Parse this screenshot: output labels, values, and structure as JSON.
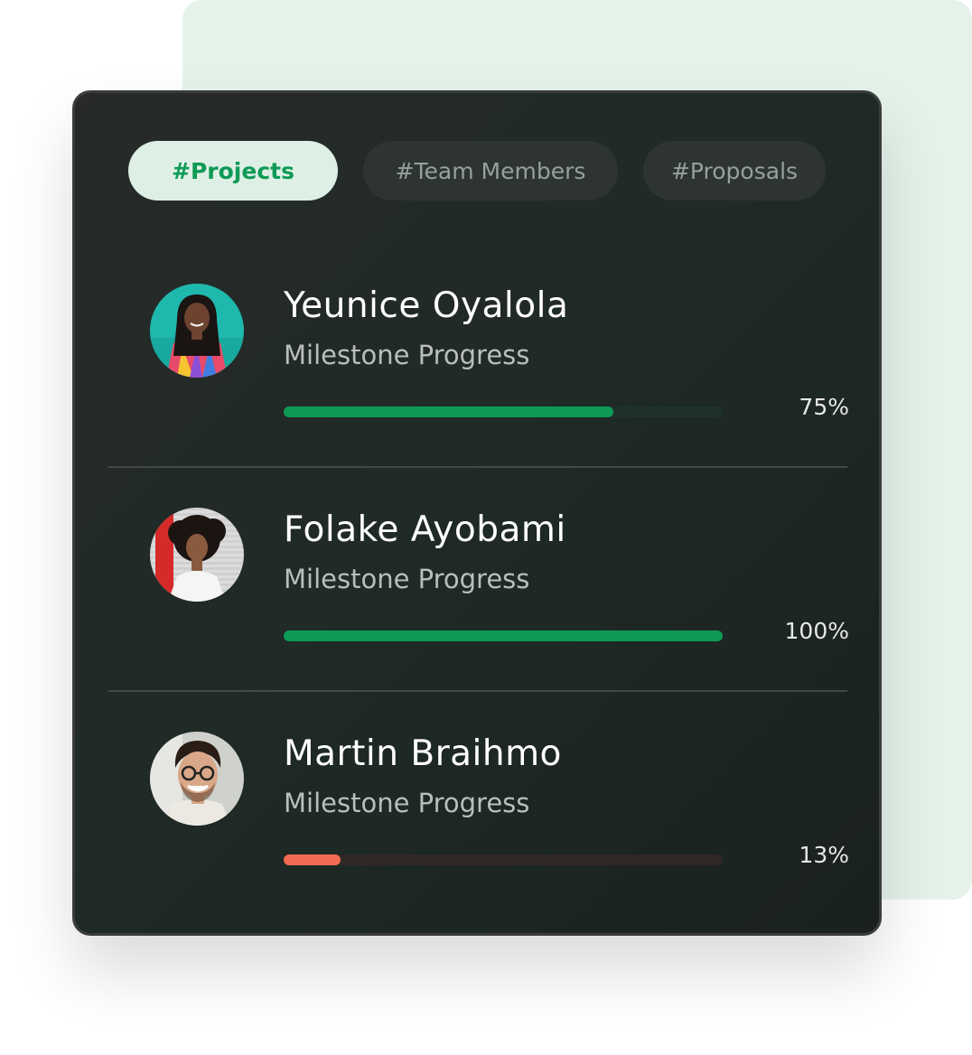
{
  "tabs": [
    {
      "label": "#Projects",
      "active": true
    },
    {
      "label": "#Team Members",
      "active": false
    },
    {
      "label": "#Proposals",
      "active": false
    }
  ],
  "members": [
    {
      "name": "Yeunice Oyalola",
      "subtitle": "Milestone Progress",
      "progress": 0.75,
      "progress_label": "75%",
      "bar_color": "#0e9a55",
      "track_color": "#1e3229"
    },
    {
      "name": "Folake Ayobami",
      "subtitle": "Milestone Progress",
      "progress": 1.0,
      "progress_label": "100%",
      "bar_color": "#0e9a55",
      "track_color": "#1e3229"
    },
    {
      "name": "Martin Braihmo",
      "subtitle": "Milestone Progress",
      "progress": 0.13,
      "progress_label": "13%",
      "bar_color": "#f26a54",
      "track_color": "#2f2824"
    }
  ],
  "colors": {
    "accent": "#0e9a55",
    "warning": "#f26a54",
    "background_panel": "#e4f2ea"
  }
}
